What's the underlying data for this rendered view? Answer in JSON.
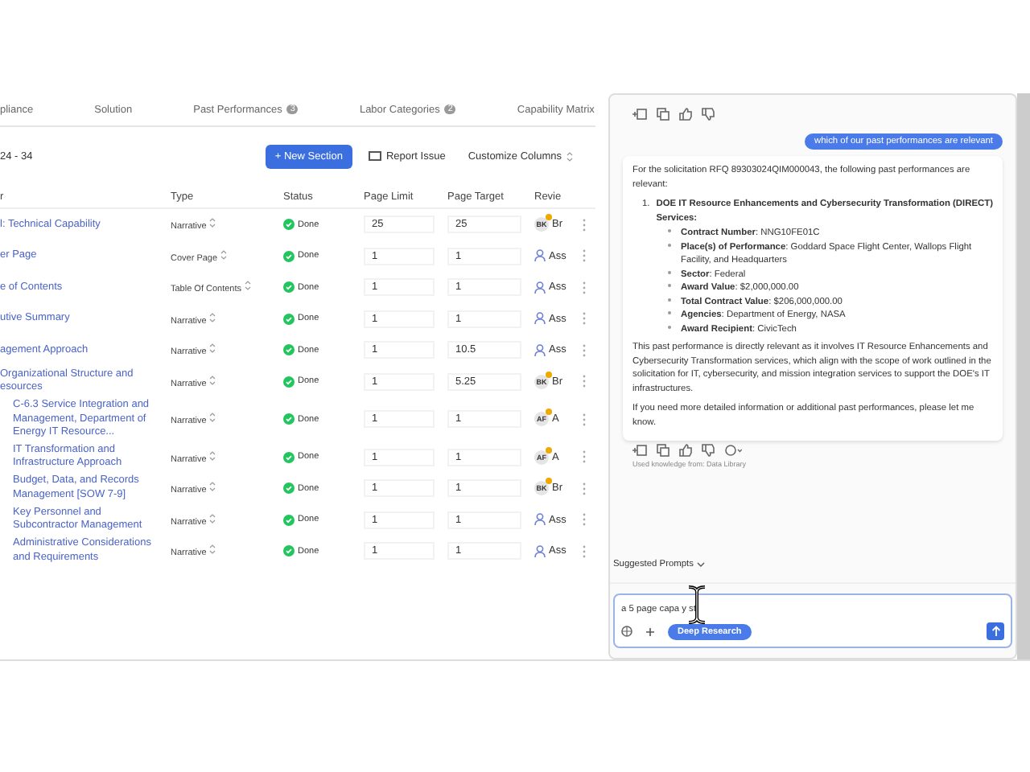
{
  "tabs": [
    {
      "label": "pliance",
      "selected": false
    },
    {
      "label": "Solution",
      "selected": false
    },
    {
      "label": "Past Performances",
      "count": "3",
      "selected": false
    },
    {
      "label": "Labor Categories",
      "count": "2",
      "selected": false
    },
    {
      "label": "Capability Matrix",
      "selected": false
    }
  ],
  "toolbar": {
    "range": "24 - 34",
    "new_button": "+ New Section",
    "report_button": "Report Issue",
    "customize_button": "Customize Columns"
  },
  "table": {
    "columns": [
      "r",
      "Type",
      "Status",
      "Page Limit",
      "Page Target",
      "Revie"
    ],
    "rows": [
      {
        "title": "l: Technical Capability",
        "type": "Narrative",
        "status": "Done",
        "page_limit": "25",
        "page_target": "25",
        "reviewer": {
          "kind": "avatar",
          "initials": "BK",
          "name": "Br"
        }
      },
      {
        "title": "er Page",
        "type": "Cover Page",
        "status": "Done",
        "page_limit": "1",
        "page_target": "1",
        "reviewer": {
          "kind": "assign",
          "name": "Ass"
        }
      },
      {
        "title": "e of Contents",
        "type": "Table Of Contents",
        "status": "Done",
        "page_limit": "1",
        "page_target": "1",
        "reviewer": {
          "kind": "assign",
          "name": "Ass"
        }
      },
      {
        "title": "utive Summary",
        "type": "Narrative",
        "status": "Done",
        "page_limit": "1",
        "page_target": "1",
        "reviewer": {
          "kind": "assign",
          "name": "Ass"
        }
      },
      {
        "title": "agement Approach",
        "type": "Narrative",
        "status": "Done",
        "page_limit": "1",
        "page_target": "10.5",
        "reviewer": {
          "kind": "assign",
          "name": "Ass"
        }
      },
      {
        "title": "Organizational Structure and esources",
        "type": "Narrative",
        "status": "Done",
        "page_limit": "1",
        "page_target": "5.25",
        "reviewer": {
          "kind": "avatar",
          "initials": "BK",
          "name": "Br"
        },
        "children": [
          {
            "title": "C-6.3 Service Integration and Management, Department of Energy IT Resource...",
            "type": "Narrative",
            "status": "Done",
            "page_limit": "1",
            "page_target": "1",
            "reviewer": {
              "kind": "avatar",
              "initials": "AF",
              "name": "A"
            }
          },
          {
            "title": "IT Transformation and Infrastructure Approach",
            "type": "Narrative",
            "status": "Done",
            "page_limit": "1",
            "page_target": "1",
            "reviewer": {
              "kind": "avatar",
              "initials": "AF",
              "name": "A"
            }
          },
          {
            "title": "Budget, Data, and Records Management [SOW 7-9]",
            "type": "Narrative",
            "status": "Done",
            "page_limit": "1",
            "page_target": "1",
            "reviewer": {
              "kind": "avatar",
              "initials": "BK",
              "name": "Br"
            }
          },
          {
            "title": "Key Personnel and Subcontractor Management",
            "type": "Narrative",
            "status": "Done",
            "page_limit": "1",
            "page_target": "1",
            "reviewer": {
              "kind": "assign",
              "name": "Ass"
            }
          },
          {
            "title": "Administrative Considerations and Requirements",
            "type": "Narrative",
            "status": "Done",
            "page_limit": "1",
            "page_target": "1",
            "reviewer": {
              "kind": "assign",
              "name": "Ass"
            }
          }
        ]
      }
    ]
  },
  "chat": {
    "user_message": "which of our past performances are relevant",
    "intro": "For the solicitation RFQ 89303024QIM000043, the following past performances are relevant:",
    "item_number": "1.",
    "item_title": "DOE IT Resource Enhancements and Cybersecurity Transformation (DIRECT) Services:",
    "facts": [
      "**Contract Number**: NNG10FE01C",
      "**Place(s) of Performance**: Goddard Space Flight Center, Wallops Flight Facility, and Headquarters",
      "**Sector**: Federal",
      "**Award Value**: $2,000,000.00",
      "**Total Contract Value**: $206,000,000.00",
      "**Agencies**: Department of Energy, NASA",
      "**Award Recipient**: CivicTech"
    ],
    "paragraphs": [
      "This past performance is directly relevant as it involves IT Resource Enhancements and Cybersecurity Transformation services, which align with the scope of work outlined in the solicitation for IT, cybersecurity, and mission integration services to support the DOE's IT infrastructures.",
      "If you need more detailed information or additional past performances, please let me know."
    ],
    "source_note": "Used knowledge from: Data Library",
    "suggested": "Suggested Prompts",
    "input_value": "a 5 page capa  y st",
    "deep_research": "Deep Research"
  }
}
